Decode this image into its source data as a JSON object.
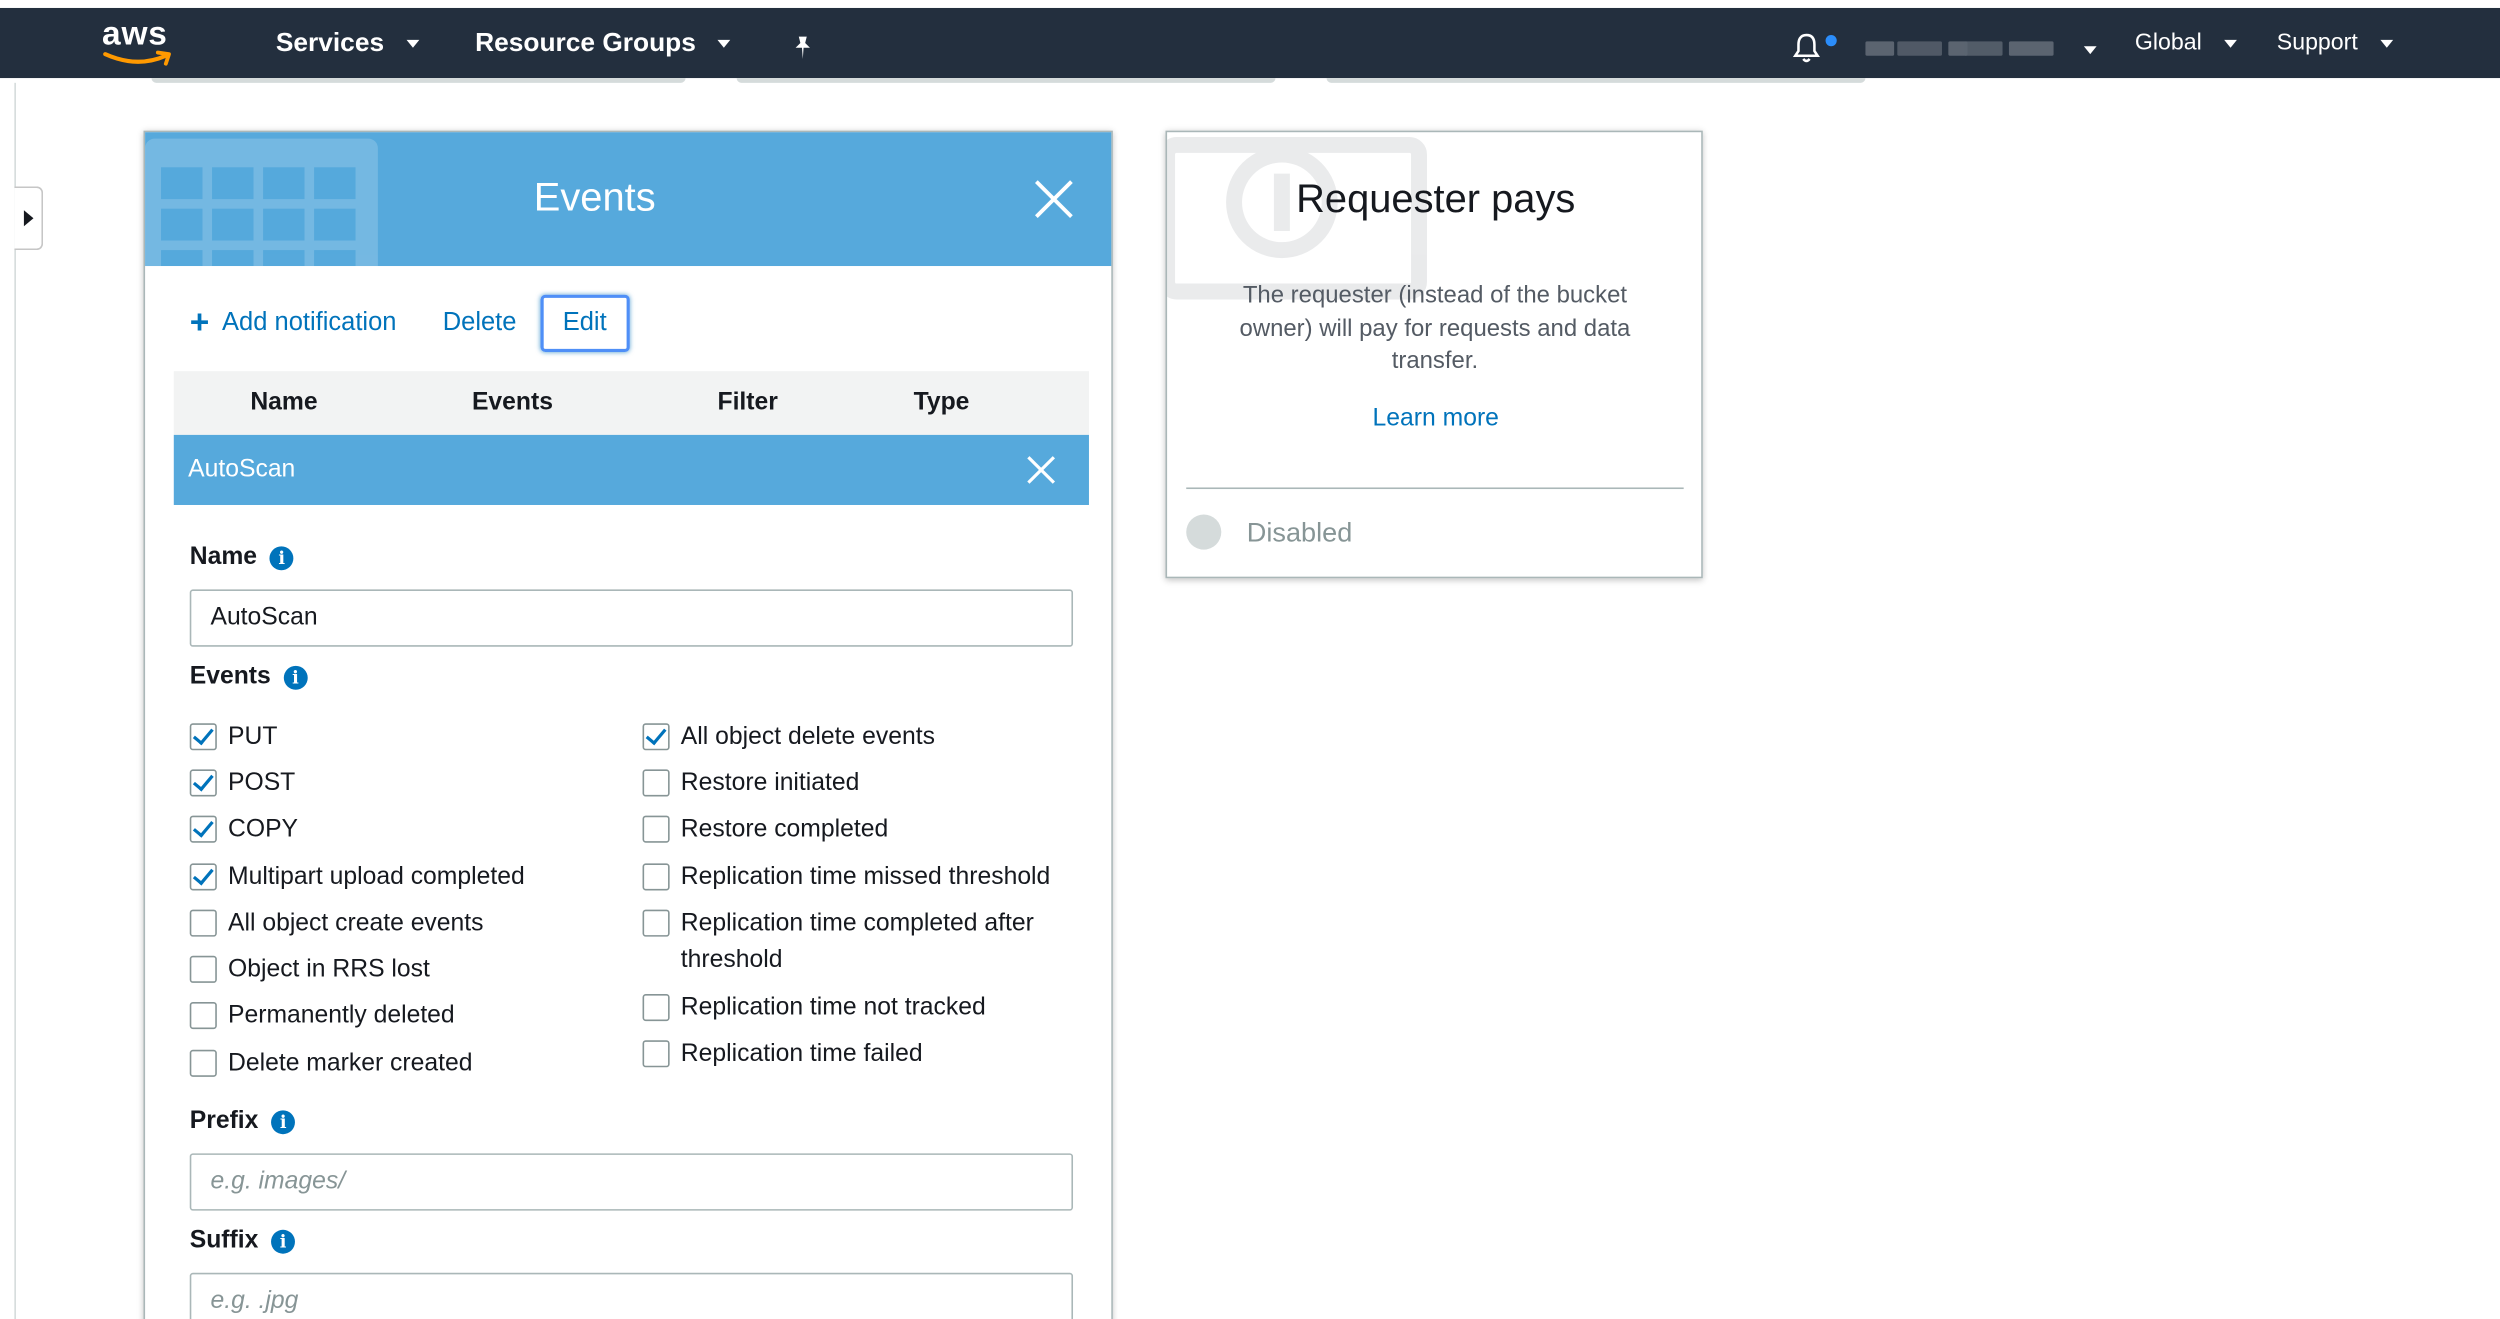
{
  "navbar": {
    "logo": "aws",
    "services": "Services",
    "resource_groups": "Resource Groups",
    "region": "Global",
    "support": "Support",
    "icons": [
      "pin-icon",
      "bell-icon",
      "chevron-down-icon"
    ]
  },
  "events_panel": {
    "title": "Events",
    "toolbar": {
      "add_notification": "Add notification",
      "delete": "Delete",
      "edit": "Edit"
    },
    "table": {
      "columns": [
        "Name",
        "Events",
        "Filter",
        "Type"
      ],
      "selected_row": "AutoScan"
    },
    "form": {
      "name_label": "Name",
      "name_value": "AutoScan",
      "events_label": "Events",
      "events_left": [
        {
          "label": "PUT",
          "checked": true
        },
        {
          "label": "POST",
          "checked": true
        },
        {
          "label": "COPY",
          "checked": true
        },
        {
          "label": "Multipart upload completed",
          "checked": true
        },
        {
          "label": "All object create events",
          "checked": false
        },
        {
          "label": "Object in RRS lost",
          "checked": false
        },
        {
          "label": "Permanently deleted",
          "checked": false
        },
        {
          "label": "Delete marker created",
          "checked": false
        }
      ],
      "events_right": [
        {
          "label": "All object delete events",
          "checked": true
        },
        {
          "label": "Restore initiated",
          "checked": false
        },
        {
          "label": "Restore completed",
          "checked": false
        },
        {
          "label": "Replication time missed threshold",
          "checked": false
        },
        {
          "label": "Replication time completed after",
          "label2": "threshold",
          "checked": false
        },
        {
          "label": "Replication time not tracked",
          "checked": false
        },
        {
          "label": "Replication time failed",
          "checked": false
        }
      ],
      "prefix_label": "Prefix",
      "prefix_placeholder": "e.g. images/",
      "suffix_label": "Suffix",
      "suffix_placeholder": "e.g. .jpg"
    }
  },
  "requester_pays": {
    "title": "Requester pays",
    "description": "The requester (instead of the bucket owner) will pay for requests and data transfer.",
    "learn_more": "Learn more",
    "status": "Disabled"
  },
  "colors": {
    "nav_bg": "#232f3e",
    "header_blue": "#56a9dc",
    "link_blue": "#0073bb"
  }
}
